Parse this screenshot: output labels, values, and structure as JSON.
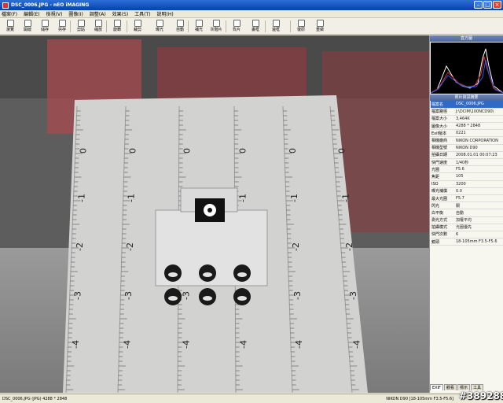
{
  "window": {
    "title": "DSC_0006.JPG - nEO iMAGING"
  },
  "menu": [
    "檔案(F)",
    "編輯(E)",
    "檢視(V)",
    "圖像(I)",
    "調整(A)",
    "效果(S)",
    "工具(T)",
    "說明(H)"
  ],
  "toolbar": [
    {
      "label": "瀏覽",
      "icon": "browse-icon"
    },
    {
      "label": "開啟",
      "icon": "open-icon"
    },
    {
      "label": "儲存",
      "icon": "save-icon"
    },
    {
      "label": "另存",
      "icon": "save-as-icon"
    },
    {
      "label": "剪貼",
      "icon": "clipboard-icon"
    },
    {
      "label": "縮放",
      "icon": "zoom-icon"
    },
    {
      "label": "旋轉",
      "icon": "rotate-icon"
    },
    {
      "label": "裁剪",
      "icon": "crop-icon"
    },
    {
      "label": "自動",
      "icon": "auto-icon"
    },
    {
      "label": "曝光",
      "icon": "exposure-icon"
    },
    {
      "label": "補光",
      "icon": "fill-light-icon"
    },
    {
      "label": "灰階片",
      "icon": "grayscale-icon"
    },
    {
      "label": "負片",
      "icon": "negative-icon"
    },
    {
      "label": "畫框",
      "icon": "frame-icon"
    },
    {
      "label": "邊框",
      "icon": "border-icon"
    },
    {
      "label": "復原",
      "icon": "undo-icon"
    },
    {
      "label": "重做",
      "icon": "redo-icon"
    }
  ],
  "panel": {
    "histogram_title": "直方圖",
    "info_title": "照片資訊摘要",
    "rows": [
      {
        "key": "檔案名",
        "value": "DSC_0006.JPG"
      },
      {
        "key": "檔案路徑",
        "value": "J:\\DCIM\\100NCD90\\"
      },
      {
        "key": "檔案大小",
        "value": "3,464K"
      },
      {
        "key": "圖像大小",
        "value": "4288 * 2848"
      },
      {
        "key": "Exif版本",
        "value": "0221"
      },
      {
        "key": "相機廠商",
        "value": "NIKON CORPORATION"
      },
      {
        "key": "相機型號",
        "value": "NIKON D90"
      },
      {
        "key": "拍攝日期",
        "value": "2008.01.01 00:07:23"
      },
      {
        "key": "快門速度",
        "value": "1/40秒"
      },
      {
        "key": "光圈",
        "value": "F5.6"
      },
      {
        "key": "焦距",
        "value": "105"
      },
      {
        "key": "ISO",
        "value": "3200"
      },
      {
        "key": "曝光補償",
        "value": "0.0"
      },
      {
        "key": "最大光圈",
        "value": "F5.7"
      },
      {
        "key": "閃光",
        "value": "關"
      },
      {
        "key": "白平衡",
        "value": "自動"
      },
      {
        "key": "測光方式",
        "value": "加權平均"
      },
      {
        "key": "拍攝模式",
        "value": "光圈優先"
      },
      {
        "key": "快門次數",
        "value": "6"
      },
      {
        "key": "鏡頭",
        "value": "18-105mm F3.5-F5.6"
      }
    ],
    "tabs": [
      "EXIF",
      "觀看",
      "標示",
      "工具"
    ]
  },
  "status": {
    "left": "DSC_0006.JPG (JPG)  4288 * 2848",
    "right": "NIKON D90 [18-105mm F3.5-F5.6]"
  },
  "watermark": "#389288",
  "photo": {
    "ruler_labels": [
      "0",
      "-1",
      "-2",
      "-3",
      "-4"
    ]
  },
  "colors": {
    "accent": "#316ac5",
    "titlebar": "#0a3fb0"
  }
}
